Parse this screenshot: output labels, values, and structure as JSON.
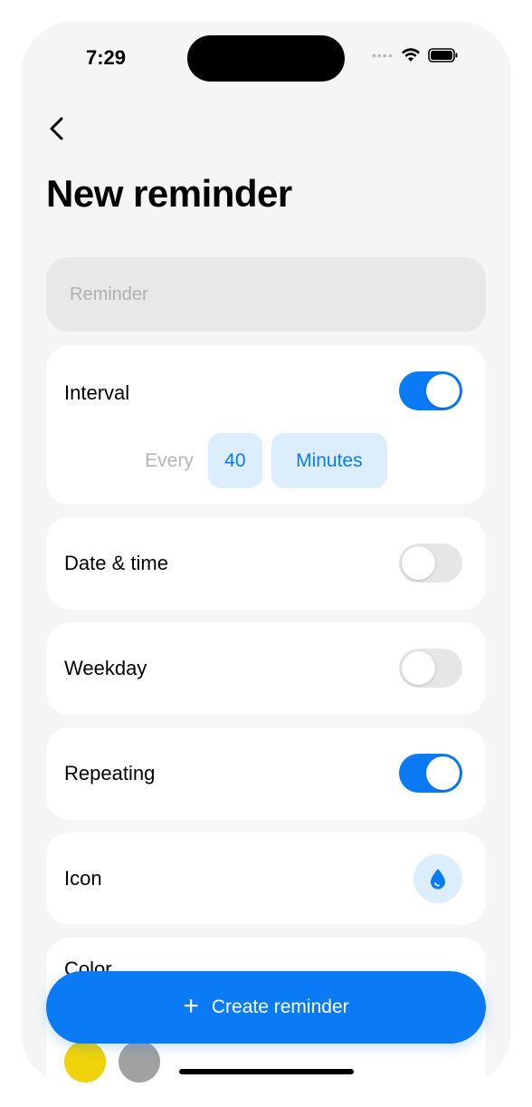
{
  "status_bar": {
    "time": "7:29",
    "signal_icon": "signal-dots-icon",
    "wifi_icon": "wifi-icon",
    "battery_icon": "battery-icon"
  },
  "nav": {
    "back_icon": "chevron-left-icon"
  },
  "page": {
    "title": "New reminder"
  },
  "reminder_field": {
    "placeholder": "Reminder",
    "value": ""
  },
  "interval": {
    "label": "Interval",
    "enabled": true,
    "every_label": "Every",
    "amount": "40",
    "unit": "Minutes"
  },
  "date_time": {
    "label": "Date & time",
    "enabled": false
  },
  "weekday": {
    "label": "Weekday",
    "enabled": false
  },
  "repeating": {
    "label": "Repeating",
    "enabled": true
  },
  "icon_section": {
    "label": "Icon",
    "selected_icon": "water-drop-icon"
  },
  "color_section": {
    "label": "Color",
    "swatches": [
      "#f0d20a",
      "#a1a1a1"
    ]
  },
  "create_button": {
    "label": "Create reminder",
    "icon": "plus-icon"
  },
  "colors": {
    "accent": "#0a7bf4",
    "accent_light": "#dceefe",
    "background": "#f5f5f5"
  }
}
